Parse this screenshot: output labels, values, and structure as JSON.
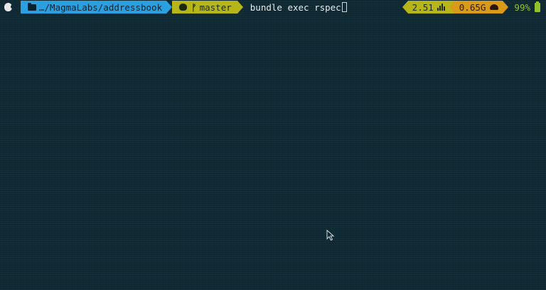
{
  "prompt": {
    "path": "…/MagmaLabs/addressbook",
    "branch": "master",
    "command": "bundle exec rspec"
  },
  "status": {
    "load_average": "2.51",
    "memory": "0.65G",
    "battery": "99%"
  },
  "icons": {
    "os": "apple-icon",
    "folder": "folder-icon",
    "vcs": "github-icon",
    "branch": "git-branch-icon",
    "load": "bar-chart-icon",
    "memory": "gauge-icon",
    "battery": "battery-icon"
  },
  "colors": {
    "background": "#0f2a34",
    "path_segment": "#2aa0e0",
    "vcs_segment": "#b6b61a",
    "memory_segment": "#d99a1a",
    "battery_text": "#93c32a"
  }
}
